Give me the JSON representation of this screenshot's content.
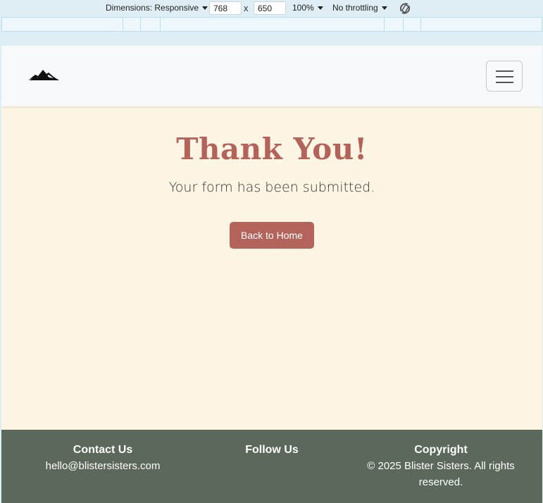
{
  "devtools": {
    "dimensions_label": "Dimensions: Responsive",
    "width_value": "768",
    "times": "x",
    "height_value": "650",
    "zoom": "100%",
    "throttling": "No throttling"
  },
  "navbar": {
    "logo_icon": "mountain-logo-icon",
    "menu_icon": "hamburger-menu-icon"
  },
  "main": {
    "title": "Thank You!",
    "message": "Your form has been submitted.",
    "home_button": "Back to Home"
  },
  "footer": {
    "contact_heading": "Contact Us",
    "contact_email": "hello@blistersisters.com",
    "follow_heading": "Follow Us",
    "copyright_heading": "Copyright",
    "copyright_text": "© 2025 Blister Sisters. All rights reserved."
  },
  "colors": {
    "accent": "#b4635a",
    "page_bg": "#fdf5e4",
    "footer_bg": "#5c685c",
    "navbar_bg": "#f8f9fa"
  }
}
